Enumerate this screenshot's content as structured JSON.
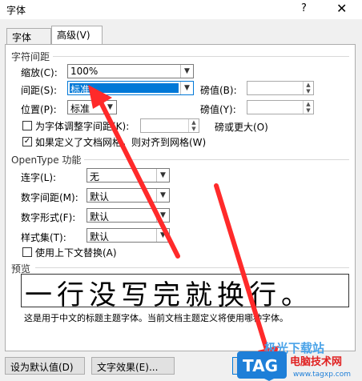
{
  "window": {
    "title": "字体",
    "help_glyph": "?",
    "close_glyph": "✕"
  },
  "tabs": [
    {
      "label": "字体(N)"
    },
    {
      "label": "高级(V)"
    }
  ],
  "spacing_group": {
    "title": "字符间距",
    "scale": {
      "label": "缩放(C):",
      "value": "100%"
    },
    "spacing": {
      "label": "间距(S):",
      "value": "标准",
      "amount_label": "磅值(B):"
    },
    "position": {
      "label": "位置(P):",
      "value": "标准",
      "amount_label": "磅值(Y):"
    },
    "kerning": {
      "label": "为字体调整字间距(K):",
      "suffix": "磅或更大(O)",
      "checked": false
    },
    "snap_grid": {
      "label": "如果定义了文档网格，则对齐到网格(W)",
      "checked": true
    }
  },
  "opentype_group": {
    "title": "OpenType 功能",
    "ligatures": {
      "label": "连字(L):",
      "value": "无"
    },
    "number_spacing": {
      "label": "数字间距(M):",
      "value": "默认"
    },
    "number_forms": {
      "label": "数字形式(F):",
      "value": "默认"
    },
    "stylistic_sets": {
      "label": "样式集(T):",
      "value": "默认"
    },
    "contextual_alternates": {
      "label": "使用上下文替换(A)",
      "checked": false
    }
  },
  "preview": {
    "title": "预览",
    "sample": "一行没写完就换行。",
    "description": "这是用于中文的标题主题字体。当前文档主题定义将使用哪种字体。"
  },
  "buttons": {
    "set_default": "设为默认值(D)",
    "text_effects": "文字效果(E)...",
    "ok_partial": "确"
  },
  "watermark": {
    "site_cn": "极光下载站",
    "tag": "TAG",
    "name": "电脑技术网",
    "url": "www.tagxp.com"
  },
  "colors": {
    "accent": "#0078d7",
    "arrow": "#ff2a2a"
  }
}
